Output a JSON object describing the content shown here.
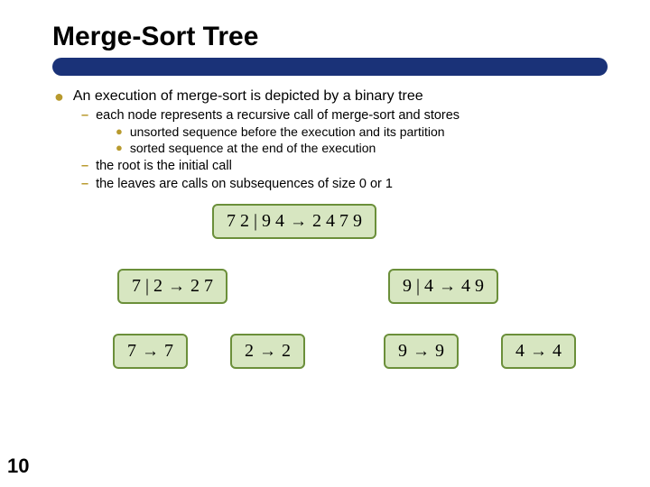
{
  "title": "Merge-Sort Tree",
  "page_number": "10",
  "body": {
    "l1": "An execution of merge-sort is depicted by a binary tree",
    "l2a": "each node represents a recursive call of merge-sort and stores",
    "l3a": "unsorted sequence before the execution and its partition",
    "l3b": "sorted sequence at the end of the execution",
    "l2b": "the root is the initial call",
    "l2c": "the leaves are calls on subsequences of size 0 or 1"
  },
  "tree": {
    "root": {
      "left": "7  2 | 9  4",
      "right": "2  4  7  9"
    },
    "n1": {
      "left": "7 | 2",
      "right": "2  7"
    },
    "n2": {
      "left": "9 | 4",
      "right": "4  9"
    },
    "leaf1": {
      "left": "7",
      "right": "7"
    },
    "leaf2": {
      "left": "2",
      "right": "2"
    },
    "leaf3": {
      "left": "9",
      "right": "9"
    },
    "leaf4": {
      "left": "4",
      "right": "4"
    }
  },
  "arrow_glyph": "→"
}
